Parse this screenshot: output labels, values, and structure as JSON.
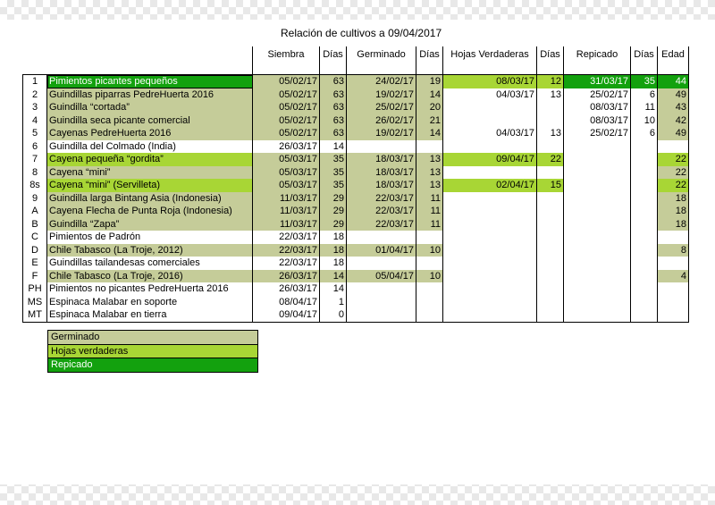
{
  "title": "Relación de cultivos a 09/04/2017",
  "headers": {
    "siembra": "Siembra",
    "dias1": "Días",
    "germinado": "Germinado",
    "dias2": "Días",
    "hojas": "Hojas Verdaderas",
    "dias3": "Días",
    "repicado": "Repicado",
    "dias4": "Días",
    "edad": "Edad"
  },
  "rows": [
    {
      "id": "1",
      "name": "Pimientos picantes pequeños",
      "siembra": "05/02/17",
      "dias1": "63",
      "germinado": "24/02/17",
      "dias2": "19",
      "hojas": "08/03/17",
      "dias3": "12",
      "repicado": "31/03/17",
      "dias4": "35",
      "edad": "44",
      "style": "rep"
    },
    {
      "id": "2",
      "name": "Guindillas piparras PedreHuerta 2016",
      "siembra": "05/02/17",
      "dias1": "63",
      "germinado": "19/02/17",
      "dias2": "14",
      "hojas": "04/03/17",
      "dias3": "13",
      "repicado": "25/02/17",
      "dias4": "6",
      "edad": "49",
      "style": "germ"
    },
    {
      "id": "3",
      "name": "Guindilla “cortada”",
      "siembra": "05/02/17",
      "dias1": "63",
      "germinado": "25/02/17",
      "dias2": "20",
      "hojas": "",
      "dias3": "",
      "repicado": "08/03/17",
      "dias4": "11",
      "edad": "43",
      "style": "germ"
    },
    {
      "id": "4",
      "name": "Guindilla seca picante comercial",
      "siembra": "05/02/17",
      "dias1": "63",
      "germinado": "26/02/17",
      "dias2": "21",
      "hojas": "",
      "dias3": "",
      "repicado": "08/03/17",
      "dias4": "10",
      "edad": "42",
      "style": "germ"
    },
    {
      "id": "5",
      "name": "Cayenas PedreHuerta 2016",
      "siembra": "05/02/17",
      "dias1": "63",
      "germinado": "19/02/17",
      "dias2": "14",
      "hojas": "04/03/17",
      "dias3": "13",
      "repicado": "25/02/17",
      "dias4": "6",
      "edad": "49",
      "style": "germ"
    },
    {
      "id": "6",
      "name": "Guindilla del Colmado (India)",
      "siembra": "26/03/17",
      "dias1": "14",
      "germinado": "",
      "dias2": "",
      "hojas": "",
      "dias3": "",
      "repicado": "",
      "dias4": "",
      "edad": "",
      "style": "none"
    },
    {
      "id": "7",
      "name": "Cayena pequeña “gordita”",
      "siembra": "05/03/17",
      "dias1": "35",
      "germinado": "18/03/17",
      "dias2": "13",
      "hojas": "09/04/17",
      "dias3": "22",
      "repicado": "",
      "dias4": "",
      "edad": "22",
      "style": "hojas"
    },
    {
      "id": "8",
      "name": "Cayena “mini”",
      "siembra": "05/03/17",
      "dias1": "35",
      "germinado": "18/03/17",
      "dias2": "13",
      "hojas": "",
      "dias3": "",
      "repicado": "",
      "dias4": "",
      "edad": "22",
      "style": "germ"
    },
    {
      "id": "8s",
      "name": "Cayena “mini” (Servilleta)",
      "siembra": "05/03/17",
      "dias1": "35",
      "germinado": "18/03/17",
      "dias2": "13",
      "hojas": "02/04/17",
      "dias3": "15",
      "repicado": "",
      "dias4": "",
      "edad": "22",
      "style": "hojas"
    },
    {
      "id": "9",
      "name": "Guindilla larga Bintang Asia (Indonesia)",
      "siembra": "11/03/17",
      "dias1": "29",
      "germinado": "22/03/17",
      "dias2": "11",
      "hojas": "",
      "dias3": "",
      "repicado": "",
      "dias4": "",
      "edad": "18",
      "style": "germ"
    },
    {
      "id": "A",
      "name": "Cayena Flecha de Punta Roja (Indonesia)",
      "siembra": "11/03/17",
      "dias1": "29",
      "germinado": "22/03/17",
      "dias2": "11",
      "hojas": "",
      "dias3": "",
      "repicado": "",
      "dias4": "",
      "edad": "18",
      "style": "germ"
    },
    {
      "id": "B",
      "name": "Guindilla “Zapa”",
      "siembra": "11/03/17",
      "dias1": "29",
      "germinado": "22/03/17",
      "dias2": "11",
      "hojas": "",
      "dias3": "",
      "repicado": "",
      "dias4": "",
      "edad": "18",
      "style": "germ"
    },
    {
      "id": "C",
      "name": "Pimientos de Padrón",
      "siembra": "22/03/17",
      "dias1": "18",
      "germinado": "",
      "dias2": "",
      "hojas": "",
      "dias3": "",
      "repicado": "",
      "dias4": "",
      "edad": "",
      "style": "none"
    },
    {
      "id": "D",
      "name": "Chile Tabasco (La Troje, 2012)",
      "siembra": "22/03/17",
      "dias1": "18",
      "germinado": "01/04/17",
      "dias2": "10",
      "hojas": "",
      "dias3": "",
      "repicado": "",
      "dias4": "",
      "edad": "8",
      "style": "germ"
    },
    {
      "id": "E",
      "name": "Guindillas tailandesas comerciales",
      "siembra": "22/03/17",
      "dias1": "18",
      "germinado": "",
      "dias2": "",
      "hojas": "",
      "dias3": "",
      "repicado": "",
      "dias4": "",
      "edad": "",
      "style": "none"
    },
    {
      "id": "F",
      "name": "Chile Tabasco (La Troje, 2016)",
      "siembra": "26/03/17",
      "dias1": "14",
      "germinado": "05/04/17",
      "dias2": "10",
      "hojas": "",
      "dias3": "",
      "repicado": "",
      "dias4": "",
      "edad": "4",
      "style": "germ"
    },
    {
      "id": "PH",
      "name": "Pimientos no picantes PedreHuerta 2016",
      "siembra": "26/03/17",
      "dias1": "14",
      "germinado": "",
      "dias2": "",
      "hojas": "",
      "dias3": "",
      "repicado": "",
      "dias4": "",
      "edad": "",
      "style": "none"
    },
    {
      "id": "MS",
      "name": "Espinaca Malabar en soporte",
      "siembra": "08/04/17",
      "dias1": "1",
      "germinado": "",
      "dias2": "",
      "hojas": "",
      "dias3": "",
      "repicado": "",
      "dias4": "",
      "edad": "",
      "style": "none"
    },
    {
      "id": "MT",
      "name": "Espinaca Malabar en tierra",
      "siembra": "09/04/17",
      "dias1": "0",
      "germinado": "",
      "dias2": "",
      "hojas": "",
      "dias3": "",
      "repicado": "",
      "dias4": "",
      "edad": "",
      "style": "none"
    }
  ],
  "legend": {
    "germinado": "Germinado",
    "hojas": "Hojas verdaderas",
    "repicado": "Repicado"
  },
  "colors": {
    "germinado": "#c5cc99",
    "hojas_verdaderas": "#a8d635",
    "repicado": "#13a10e"
  }
}
